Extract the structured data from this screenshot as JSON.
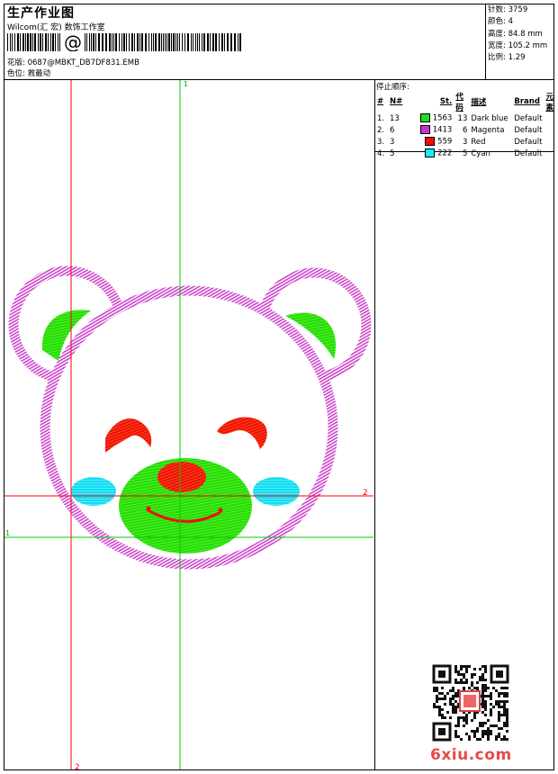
{
  "header": {
    "title": "生产作业图",
    "studio": "Wilcom(汇 宏) 数饰工作室",
    "barcode_text": "@",
    "file_line": "花版: 0687@MBKT_DB7DF831.EMB",
    "color_line": "色位: 救最动"
  },
  "stats": [
    {
      "label": "针数",
      "value": "3759"
    },
    {
      "label": "颜色",
      "value": "4"
    },
    {
      "label": "高度",
      "value": "84.8 mm"
    },
    {
      "label": "宽度",
      "value": "105.2 mm"
    },
    {
      "label": "比例",
      "value": "1.29"
    }
  ],
  "stop_sequence": {
    "label": "停止顺序:",
    "columns": [
      "#",
      "N#",
      "St.",
      "代码",
      "描述",
      "Brand",
      "元素"
    ],
    "rows": [
      {
        "idx": "1.",
        "n": "13",
        "color": "#22dd22",
        "stitches": "1563",
        "code": "13",
        "desc": "Dark blue",
        "brand": "Default"
      },
      {
        "idx": "2.",
        "n": "6",
        "color": "#cc33cc",
        "stitches": "1413",
        "code": "6",
        "desc": "Magenta",
        "brand": "Default"
      },
      {
        "idx": "3.",
        "n": "3",
        "color": "#ee1100",
        "stitches": "559",
        "code": "3",
        "desc": "Red",
        "brand": "Default"
      },
      {
        "idx": "4.",
        "n": "5",
        "color": "#11eeff",
        "stitches": "222",
        "code": "5",
        "desc": "Cyan",
        "brand": "Default"
      }
    ]
  },
  "guides": {
    "green_top": "1",
    "green_left": "1",
    "red_right": "2",
    "red_bottom": "2"
  },
  "colors": {
    "outline": "#cc44cc",
    "green": "#22dd00",
    "red": "#ee1100",
    "cyan": "#11ddf0",
    "guide_red": "#ff0000",
    "guide_green": "#00cc00"
  },
  "watermark": {
    "text": "6xiu.com",
    "color": "#e74a48"
  }
}
